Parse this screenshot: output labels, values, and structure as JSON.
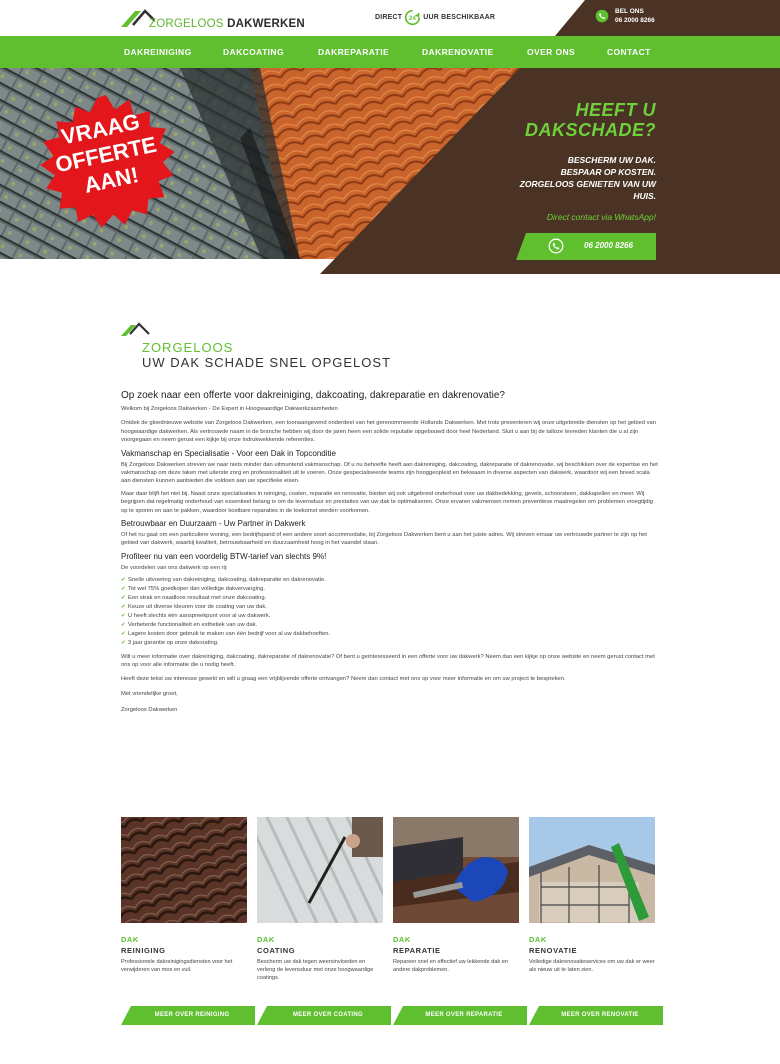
{
  "header": {
    "logo_word1": "ZORGELOOS",
    "logo_word2": "DAKWERKEN",
    "direct_label": "DIRECT",
    "hours_badge": "24",
    "availability_label": "UUR BESCHIKBAAR",
    "call_label": "BEL ONS",
    "phone": "06 2000 8266"
  },
  "nav": {
    "items": [
      {
        "label": "DAKREINIGING"
      },
      {
        "label": "DAKCOATING"
      },
      {
        "label": "DAKREPARATIE"
      },
      {
        "label": "DAKRENOVATIE"
      },
      {
        "label": "OVER ONS"
      },
      {
        "label": "CONTACT"
      }
    ]
  },
  "hero": {
    "badge_line1": "VRAAG",
    "badge_line2": "OFFERTE",
    "badge_line3": "AAN!",
    "headline1": "HEEFT U",
    "headline2": "DAKSCHADE?",
    "line1": "BESCHERM UW DAK.",
    "line2": "BESPAAR OP KOSTEN.",
    "line3": "ZORGELOOS GENIETEN VAN UW HUIS.",
    "whatsapp_link": "Direct contact via WhatsApp!",
    "button_phone": "06 2000 8266"
  },
  "intro": {
    "title1": "ZORGELOOS",
    "title2": "UW DAK SCHADE SNEL OPGELOST"
  },
  "content": {
    "h3": "Op zoek naar een offerte voor dakreiniging, dakcoating, dakreparatie en dakrenovatie?",
    "welcome": "Welkom bij Zorgeloos Dakwerken - De Expert in Hoogwaardige Dakwerkzaamheden",
    "p1": "Ontdek de gloednieuwe website van Zorgeloos Dakwerken, een toonaangevend onderdeel van het gerenommeerde Hollands Dakwerken. Met trots presenteren wij onze uitgebreide diensten op het gebied van hoogwaardige dakwerken. Als vertrouwde naam in de branche hebben wij door de jaren heen een solide reputatie opgebouwd door heel Nederland. Sluit u aan bij de talloze tevreden klanten die u al zijn voorgegaan en neem gerust een kijkje bij onze indrukwekkende referenties.",
    "h4a": "Vakmanschap en Specialisatie - Voor een Dak in Topconditie",
    "p2": "Bij Zorgeloos Dakwerken streven we naar niets minder dan uitmuntend vakmanschap. Of u nu behoefte heeft aan dakreiniging, dakcoating, dakreparatie of dakrenovatie, wij beschikken over de expertise en het vakmanschap om deze taken met uiterste zorg en professionaliteit uit te voeren. Onze gespecialiseerde teams zijn hooggeopleid en bekwaam in diverse aspecten van dakwerk, waardoor wij een breed scala aan diensten kunnen aanbieden die voldoen aan uw specifieke eisen.",
    "p3": "Maar daar blijft het niet bij. Naast onze specialisaties in reiniging, coaten, reparatie en renovatie, bieden wij ook uitgebreid onderhoud voor uw dakbedekking, gevels, schoorsteen, dakkapellen en meer. Wij begrijpen dat regelmatig onderhoud van essentieel belang is om de levensduur en prestaties van uw dak te optimaliseren. Onze ervaren vakmensen nemen preventieve maatregelen om problemen vroegtijdig op te sporen en aan te pakken, waardoor kostbare reparaties in de toekomst worden voorkomen.",
    "h4b": "Betrouwbaar en Duurzaam - Uw Partner in Dakwerk",
    "p4": "Of het nu gaat om een particuliere woning, een bedrijfspand of een andere soort accommodatie, bij Zorgeloos Dakwerken bent u aan het juiste adres. Wij streven ernaar uw vertrouwde partner te zijn op het gebied van dakwerk, waarbij kwaliteit, betrouwbaarheid en duurzaamheid hoog in het vaandel staan.",
    "h4c": "Profiteer nu van een voordelig BTW-tarief van slechts 9%!",
    "p5": "De voordelen van ons dakwerk op een rij:",
    "bullets": [
      "Snelle uitvoering van dakreiniging, dakcoating, dakreparatie en dakrenovatie.",
      "Tot wel 75% goedkoper dan volledige dakvervanging.",
      "Een strak en naadloos resultaat met onze dakcoating.",
      "Keuze uit diverse kleuren voor de coating van uw dak.",
      "U heeft slechts één aanspreekpunt voor al uw dakwerk.",
      "Verbeterde functionaliteit en esthetiek van uw dak.",
      "Lagere kosten door gebruik te maken van één bedrijf voor al uw dakbehoeften.",
      "3 jaar garantie op onze dakcoating."
    ],
    "p6": "Wilt u meer informatie over dakreiniging, dakcoating, dakreparatie of dakrenovatie? Of bent u geïnteresseerd in een offerte voor uw dakwerk? Neem dan een kijkje op onze website en neem gerust contact met ons op voor alle informatie die u nodig heeft.",
    "p7": "Heeft deze tekst uw interesse gewekt en wilt u graag een vrijblijvende offerte ontvangen? Neem dan contact met ons op voor meer informatie en om uw project te bespreken.",
    "greeting": "Met vriendelijke groet,",
    "signature": "Zorgeloos Dakwerken"
  },
  "cards": [
    {
      "k1": "DAK",
      "k2": "REINIGING",
      "desc": "Professionele dakreinigingsdiensten voor het verwijderen van mos en vuil.",
      "button": "MEER OVER REINIGING"
    },
    {
      "k1": "DAK",
      "k2": "COATING",
      "desc": "Bescherm uw dak tegen weersinvloeden en verleng de levensduur met onze hoogwaardige coatings.",
      "button": "MEER OVER COATING"
    },
    {
      "k1": "DAK",
      "k2": "REPARATIE",
      "desc": "Repareer snel en effectief uw lekkende dak en andere dakproblemen.",
      "button": "MEER OVER REPARATIE"
    },
    {
      "k1": "DAK",
      "k2": "RENOVATIE",
      "desc": "Volledige dakrenovatieservices om uw dak er weer als nieuw uit te laten zien.",
      "button": "MEER OVER RENOVATIE"
    }
  ],
  "colors": {
    "brand_green": "#5fbf2f",
    "brand_brown": "#4a3324",
    "badge_red": "#e3171b"
  }
}
